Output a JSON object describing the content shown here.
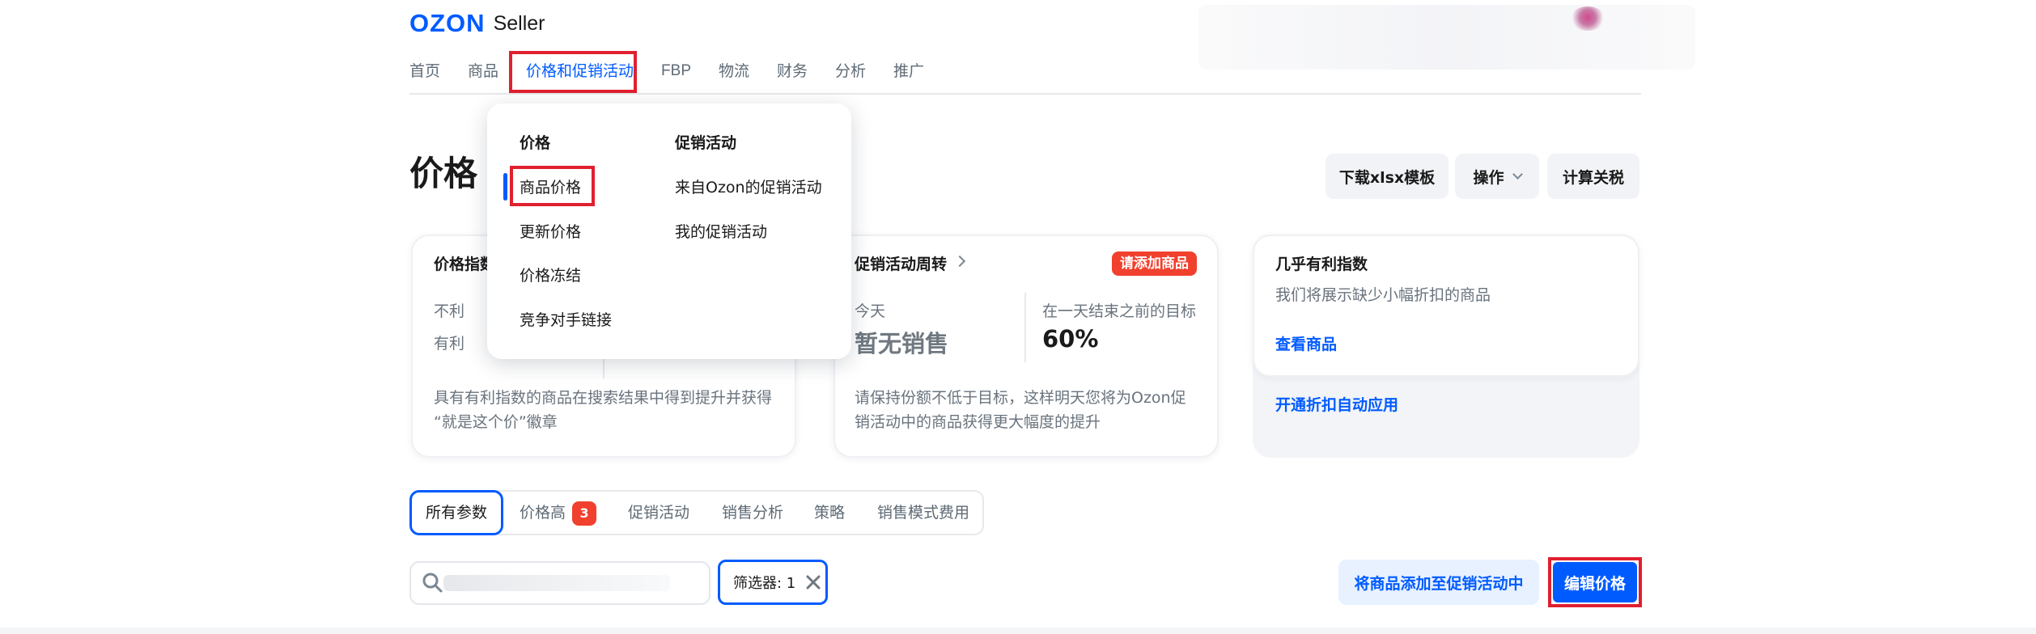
{
  "header": {
    "logo_text": "OZON",
    "logo_sub": "Seller"
  },
  "nav": {
    "items": [
      {
        "label": "首页"
      },
      {
        "label": "商品"
      },
      {
        "label": "价格和促销活动",
        "active": true
      },
      {
        "label": "FBP"
      },
      {
        "label": "物流"
      },
      {
        "label": "财务"
      },
      {
        "label": "分析"
      },
      {
        "label": "推广"
      }
    ]
  },
  "dropdown": {
    "col1_title": "价格",
    "col1_items": [
      "商品价格",
      "更新价格",
      "价格冻结",
      "竞争对手链接"
    ],
    "col2_title": "促销活动",
    "col2_items": [
      "来自Ozon的促销活动",
      "我的促销活动"
    ]
  },
  "page": {
    "title": "价格"
  },
  "top_buttons": {
    "download": "下载xlsx模板",
    "actions": "操作",
    "tariff": "计算关税"
  },
  "card1": {
    "title": "价格指数",
    "row1": "不利",
    "row2": "有利",
    "desc_line1": "具有有利指数的商品在搜索结果中得到提升并获得",
    "desc_line2": "“就是这个价”徽章"
  },
  "card2": {
    "title": "促销活动周转",
    "badge": "请添加商品",
    "today_label": "今天",
    "today_value": "暂无销售",
    "target_label": "在一天结束之前的目标",
    "target_value": "60%",
    "desc_line1": "请保持份额不低于目标，这样明天您将为Ozon促",
    "desc_line2": "销活动中的商品获得更大幅度的提升"
  },
  "card3": {
    "title": "几乎有利指数",
    "desc": "我们将展示缺少小幅折扣的商品",
    "link": "查看商品",
    "footer_link": "开通折扣自动应用"
  },
  "tabs": {
    "items": [
      {
        "label": "所有参数",
        "active": true
      },
      {
        "label": "价格高",
        "badge": "3"
      },
      {
        "label": "促销活动"
      },
      {
        "label": "销售分析"
      },
      {
        "label": "策略"
      },
      {
        "label": "销售模式费用"
      }
    ]
  },
  "toolbar": {
    "filter_label": "筛选器: 1",
    "add_to_promo": "将商品添加至促销活动中",
    "edit_price": "编辑价格"
  },
  "colors": {
    "accent": "#005bff",
    "highlight": "#e0202f",
    "badge": "#f1402e"
  }
}
